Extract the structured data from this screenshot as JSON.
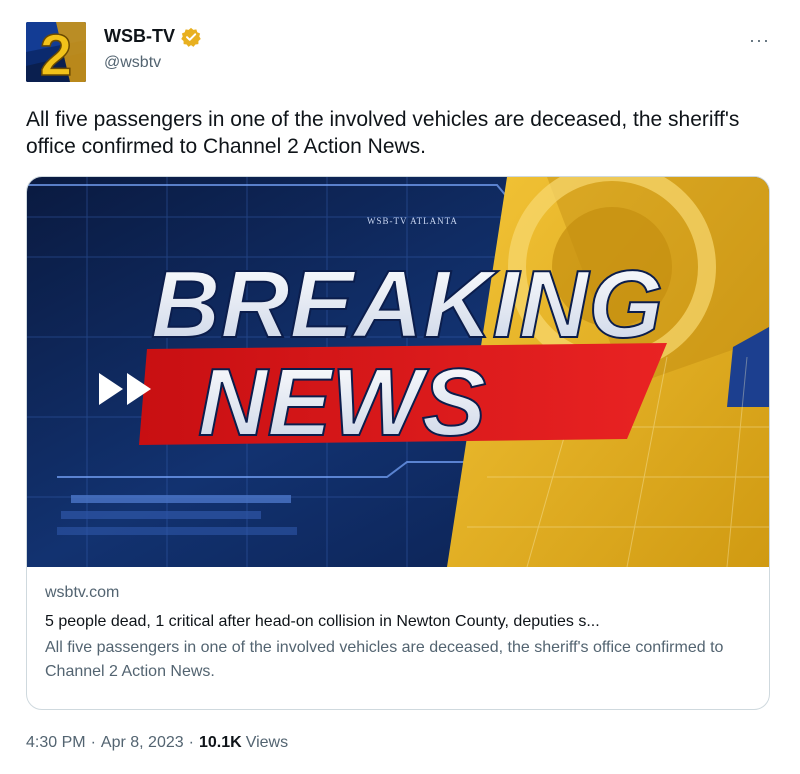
{
  "author": {
    "display_name": "WSB-TV",
    "handle": "@wsbtv",
    "avatar_text": "2",
    "verified_color": "#e8b020"
  },
  "tweet": {
    "text": "All five passengers in one of the involved vehicles are deceased, the sheriff's office confirmed to Channel 2 Action News.",
    "more_label": "···"
  },
  "card": {
    "image_text_top": "BREAKING",
    "image_text_bottom": "NEWS",
    "image_watermark": "WSB-TV ATLANTA",
    "domain": "wsbtv.com",
    "title": "5 people dead, 1 critical after head-on collision in Newton County, deputies s...",
    "description": "All five passengers in one of the involved vehicles are deceased, the sheriff's office confirmed to Channel 2 Action News."
  },
  "footer": {
    "time": "4:30 PM",
    "date": "Apr 8, 2023",
    "views_count": "10.1K",
    "views_label": "Views",
    "separator": "·"
  }
}
